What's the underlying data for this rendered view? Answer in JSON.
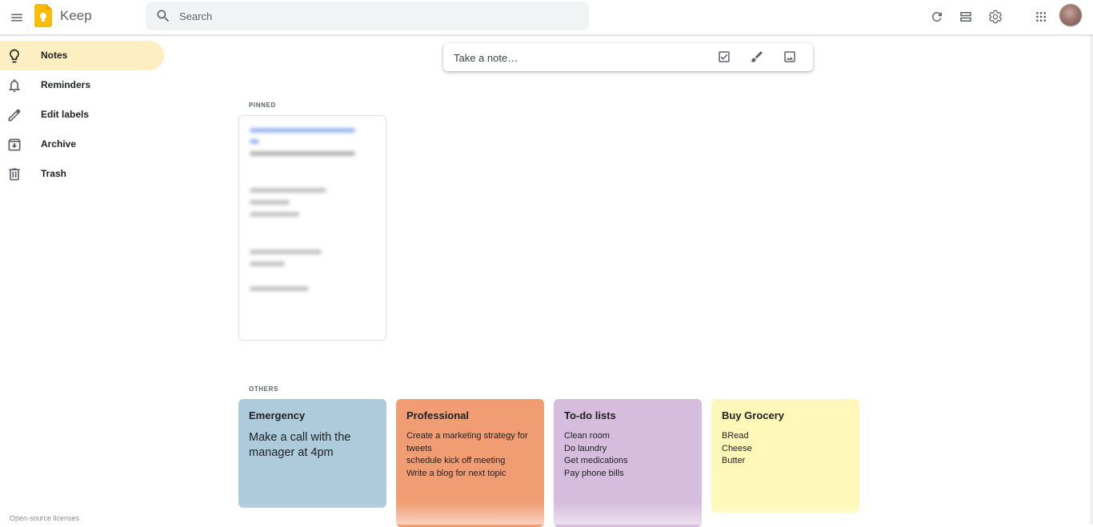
{
  "header": {
    "app_name": "Keep",
    "search_placeholder": "Search"
  },
  "sidebar": {
    "items": [
      {
        "label": "Notes",
        "icon": "lightbulb-icon",
        "active": true
      },
      {
        "label": "Reminders",
        "icon": "bell-icon",
        "active": false
      },
      {
        "label": "Edit labels",
        "icon": "pencil-icon",
        "active": false
      },
      {
        "label": "Archive",
        "icon": "archive-icon",
        "active": false
      },
      {
        "label": "Trash",
        "icon": "trash-icon",
        "active": false
      }
    ],
    "footer": "Open-source licenses"
  },
  "take_note": {
    "placeholder": "Take a note…"
  },
  "sections": {
    "pinned": "PINNED",
    "others": "OTHERS"
  },
  "notes": [
    {
      "title": "Emergency",
      "body": "Make a call with the manager at 4pm",
      "color": "#aecbdb"
    },
    {
      "title": "Professional",
      "lines": [
        "Create a marketing strategy for tweets",
        "schedule kick off meeting",
        "Write a blog for next topic"
      ],
      "color": "#f19d74"
    },
    {
      "title": "To-do lists",
      "lines": [
        "Clean room",
        "Do laundry",
        "Get medications",
        "Pay phone bills"
      ],
      "color": "#d6bddd"
    },
    {
      "title": "Buy Grocery",
      "lines": [
        "BRead",
        "Cheese",
        "Butter"
      ],
      "color": "#fff8b8"
    }
  ],
  "colors": {
    "active_nav": "#feefc3",
    "logo_yellow": "#fbbc04"
  }
}
